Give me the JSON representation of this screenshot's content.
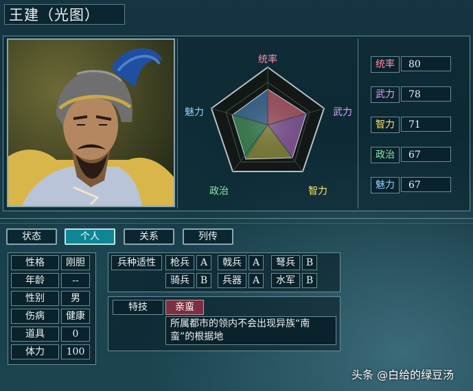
{
  "title": "王建（光图）",
  "radar": {
    "labels": {
      "top": "统率",
      "right": "武力",
      "bottom_right": "智力",
      "bottom_left": "政治",
      "left": "魅力"
    },
    "colors": {
      "top": "#ff8fa8",
      "right": "#d9a6ff",
      "bottom_right": "#ffe566",
      "bottom_left": "#8be7a6",
      "left": "#8fd0ff"
    }
  },
  "stats": [
    {
      "label": "统率",
      "value": "80",
      "color": "#ff8fa8"
    },
    {
      "label": "武力",
      "value": "78",
      "color": "#d9a6ff"
    },
    {
      "label": "智力",
      "value": "71",
      "color": "#ffe566"
    },
    {
      "label": "政治",
      "value": "67",
      "color": "#8be7a6"
    },
    {
      "label": "魅力",
      "value": "67",
      "color": "#8fd0ff"
    }
  ],
  "tabs": [
    "状态",
    "个人",
    "关系",
    "列传"
  ],
  "active_tab": "个人",
  "personal": [
    {
      "label": "性格",
      "value": "刚胆"
    },
    {
      "label": "年龄",
      "value": "--"
    },
    {
      "label": "性别",
      "value": "男"
    },
    {
      "label": "伤病",
      "value": "健康"
    },
    {
      "label": "道具",
      "value": "0"
    },
    {
      "label": "体力",
      "value": "100"
    }
  ],
  "aptitude": {
    "label": "兵种适性",
    "units": [
      {
        "name": "枪兵",
        "grade": "A"
      },
      {
        "name": "戟兵",
        "grade": "A"
      },
      {
        "name": "弩兵",
        "grade": "B"
      },
      {
        "name": "骑兵",
        "grade": "B"
      },
      {
        "name": "兵器",
        "grade": "A"
      },
      {
        "name": "水军",
        "grade": "B"
      }
    ]
  },
  "skill": {
    "label": "特技",
    "name": "亲蛮",
    "description": "所属都市的领内不会出现异族“南蛮”的根据地"
  },
  "watermark": "头条 @白给的绿豆汤"
}
